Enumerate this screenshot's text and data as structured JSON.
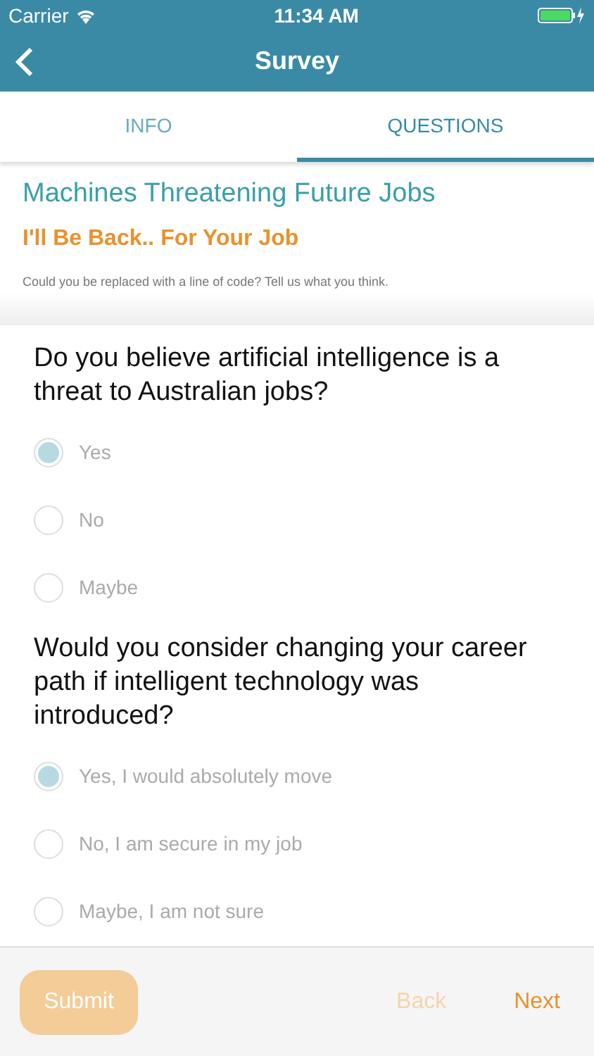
{
  "status_bar": {
    "carrier": "Carrier",
    "time": "11:34 AM"
  },
  "nav": {
    "title": "Survey"
  },
  "tabs": [
    {
      "label": "INFO",
      "selected": false
    },
    {
      "label": "QUESTIONS",
      "selected": true
    }
  ],
  "survey": {
    "title": "Machines Threatening Future Jobs",
    "subtitle": "I'll Be Back.. For Your Job",
    "description": "Could you be replaced with a line of code? Tell us what you think."
  },
  "questions": [
    {
      "text": "Do you believe artificial intelligence is a threat to Australian jobs?",
      "options": [
        {
          "label": "Yes",
          "selected": true
        },
        {
          "label": "No",
          "selected": false
        },
        {
          "label": "Maybe",
          "selected": false
        }
      ]
    },
    {
      "text": "Would you consider changing your career path if intelligent technology was introduced?",
      "options": [
        {
          "label": "Yes, I would absolutely move",
          "selected": true
        },
        {
          "label": "No, I am secure in my job",
          "selected": false
        },
        {
          "label": "Maybe, I am not sure",
          "selected": false
        }
      ]
    }
  ],
  "footer": {
    "submit": {
      "label": "Submit",
      "disabled": true
    },
    "back": {
      "label": "Back",
      "disabled": true
    },
    "next": {
      "label": "Next",
      "disabled": false
    }
  }
}
